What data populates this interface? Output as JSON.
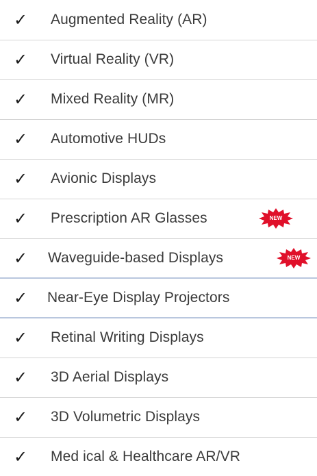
{
  "items": [
    {
      "label": "Augmented Reality (AR)"
    },
    {
      "label": "Virtual Reality (VR)"
    },
    {
      "label": "Mixed Reality (MR)"
    },
    {
      "label": "Automotive HUDs"
    },
    {
      "label": "Avionic Displays"
    },
    {
      "label": "Prescription AR Glasses",
      "badge": "NEW"
    },
    {
      "label": "Waveguide-based Displays",
      "badge": "NEW"
    },
    {
      "label": "Near-Eye Display Projectors"
    },
    {
      "label": "Retinal Writing Displays"
    },
    {
      "label": "3D Aerial Displays"
    },
    {
      "label": "3D Volumetric Displays"
    },
    {
      "label": "Med ical & Healthcare AR/VR"
    }
  ],
  "check_glyph": "✓",
  "badge_color": "#e0102a",
  "icons": {
    "check": "check-icon",
    "badge": "new-starburst-icon"
  }
}
